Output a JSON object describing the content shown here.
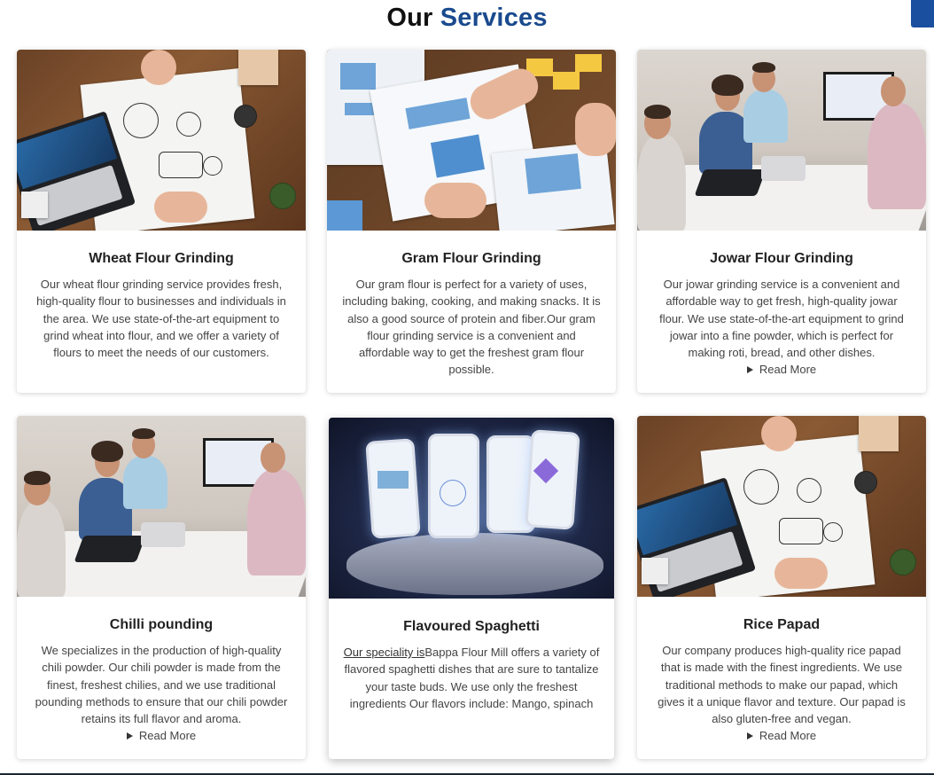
{
  "header": {
    "title_prefix": "Our",
    "title_accent": "Services",
    "accent_color": "#1a4a8e"
  },
  "cards": [
    {
      "title": "Wheat Flour Grinding",
      "image": "business-planning-desk-photo",
      "text": "Our wheat flour grinding service provides fresh, high-quality flour to businesses and individuals in the area. We use state-of-the-art equipment to grind wheat into flour, and we offer a variety of flours to meet the needs of our customers.",
      "read_more": ""
    },
    {
      "title": "Gram Flour Grinding",
      "image": "wireframe-sketching-photo",
      "text": "Our gram flour is perfect for a variety of uses, including baking, cooking, and making snacks. It is also a good source of protein and fiber.Our gram flour grinding service is a convenient and affordable way to get the freshest gram flour possible.",
      "read_more": ""
    },
    {
      "title": "Jowar Flour Grinding",
      "image": "office-meeting-photo",
      "text": "Our jowar grinding service is a convenient and affordable way to get fresh, high-quality jowar flour. We use state-of-the-art equipment to grind jowar into a fine powder, which is perfect for making roti, bread, and other dishes.",
      "read_more": "Read More"
    },
    {
      "title": "Chilli pounding",
      "image": "office-meeting-photo",
      "text": "We specializes in the production of high-quality chili powder. Our chili powder is made from the finest, freshest chilies, and we use traditional pounding methods to ensure that our chili powder retains its full flavor and aroma.",
      "read_more": "Read More"
    },
    {
      "title": "Flavoured Spaghetti",
      "image": "floating-phones-hand-photo",
      "speciality": "Our speciality is",
      "text": "Bappa Flour Mill offers a variety of flavored spaghetti dishes that are sure to tantalize your taste buds. We use only the freshest ingredients Our flavors include: Mango, spinach",
      "read_more": ""
    },
    {
      "title": "Rice Papad",
      "image": "business-planning-desk-photo",
      "text": "Our company produces high-quality rice papad that is made with the finest ingredients. We use traditional methods to make our papad, which gives it a unique flavor and texture. Our papad is also gluten-free and vegan.",
      "read_more": "Read More"
    }
  ]
}
